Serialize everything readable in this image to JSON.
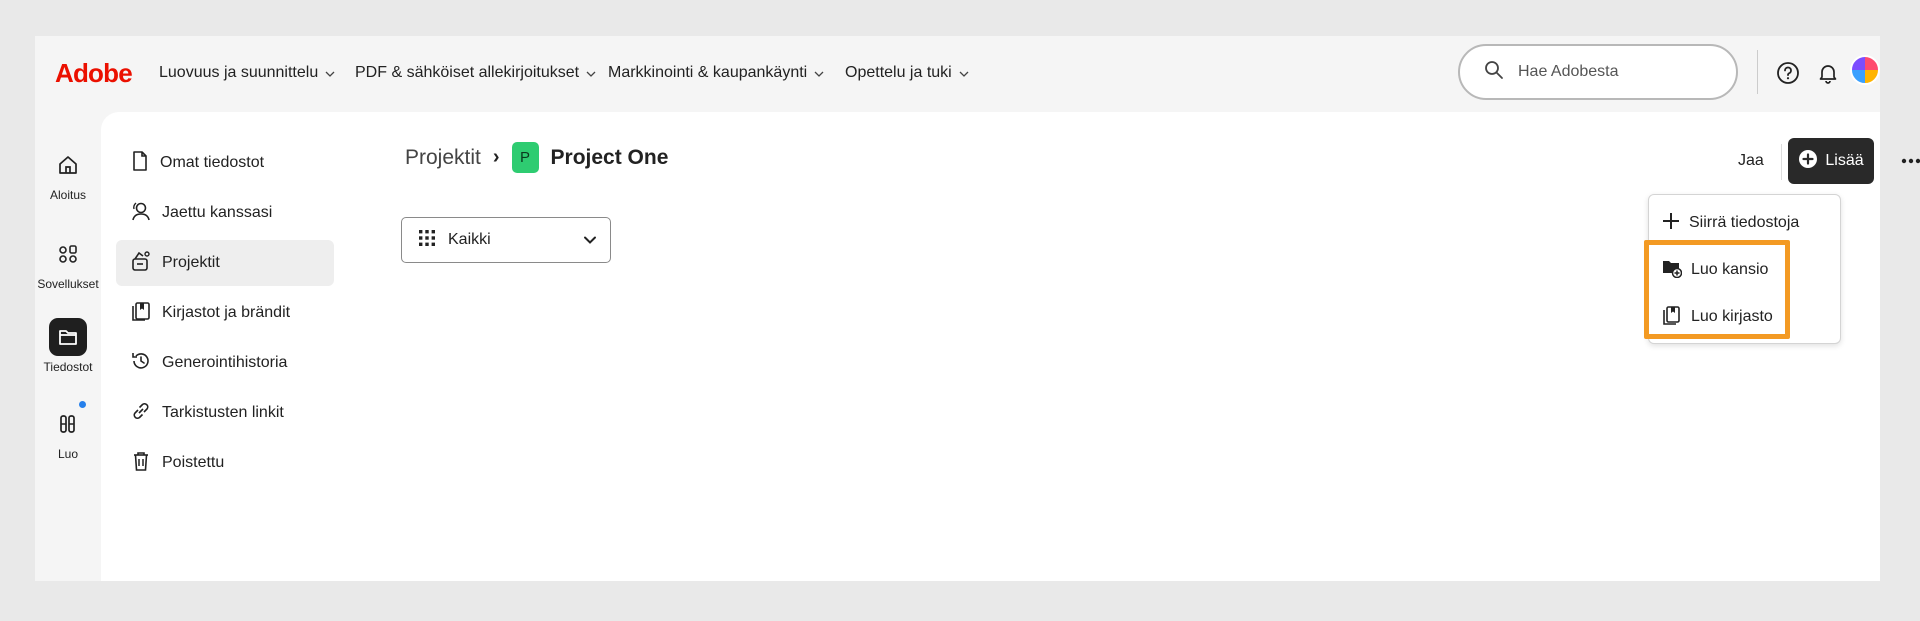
{
  "brand": {
    "logo": "Adobe",
    "logo_color": "#eb1000"
  },
  "topnav": {
    "items": [
      {
        "label": "Luovuus ja suunnittelu"
      },
      {
        "label": "PDF & sähköiset allekirjoitukset"
      },
      {
        "label": "Markkinointi & kaupankäynti"
      },
      {
        "label": "Opettelu ja tuki"
      }
    ],
    "search_placeholder": "Hae Adobesta",
    "icons": [
      "search-icon",
      "help-icon",
      "bell-icon",
      "avatar"
    ]
  },
  "rail": {
    "items": [
      {
        "label": "Aloitus",
        "icon": "home-icon"
      },
      {
        "label": "Sovellukset",
        "icon": "apps-icon"
      },
      {
        "label": "Tiedostot",
        "icon": "folder-icon",
        "active": true
      },
      {
        "label": "Luo",
        "icon": "create-icon",
        "has_notification": true
      }
    ]
  },
  "sidebar": {
    "items": [
      {
        "label": "Omat tiedostot",
        "icon": "file-icon"
      },
      {
        "label": "Jaettu kanssasi",
        "icon": "shared-user-icon"
      },
      {
        "label": "Projektit",
        "icon": "projects-icon",
        "active": true
      },
      {
        "label": "Kirjastot ja brändit",
        "icon": "library-icon"
      },
      {
        "label": "Generointihistoria",
        "icon": "history-icon"
      },
      {
        "label": "Tarkistusten linkit",
        "icon": "link-icon"
      },
      {
        "label": "Poistettu",
        "icon": "trash-icon"
      }
    ]
  },
  "breadcrumb": {
    "parent": "Projektit",
    "separator": "›",
    "badge": "P",
    "badge_color": "#2ecc71",
    "current": "Project One"
  },
  "filter": {
    "selected": "Kaikki"
  },
  "actions": {
    "share_label": "Jaa",
    "add_label": "Lisää"
  },
  "menu": {
    "items": [
      {
        "label": "Siirrä tiedostoja",
        "icon": "plus-move-icon"
      },
      {
        "label": "Luo kansio",
        "icon": "new-folder-icon"
      },
      {
        "label": "Luo kirjasto",
        "icon": "library-icon"
      }
    ],
    "highlight_color": "#f39a23"
  }
}
